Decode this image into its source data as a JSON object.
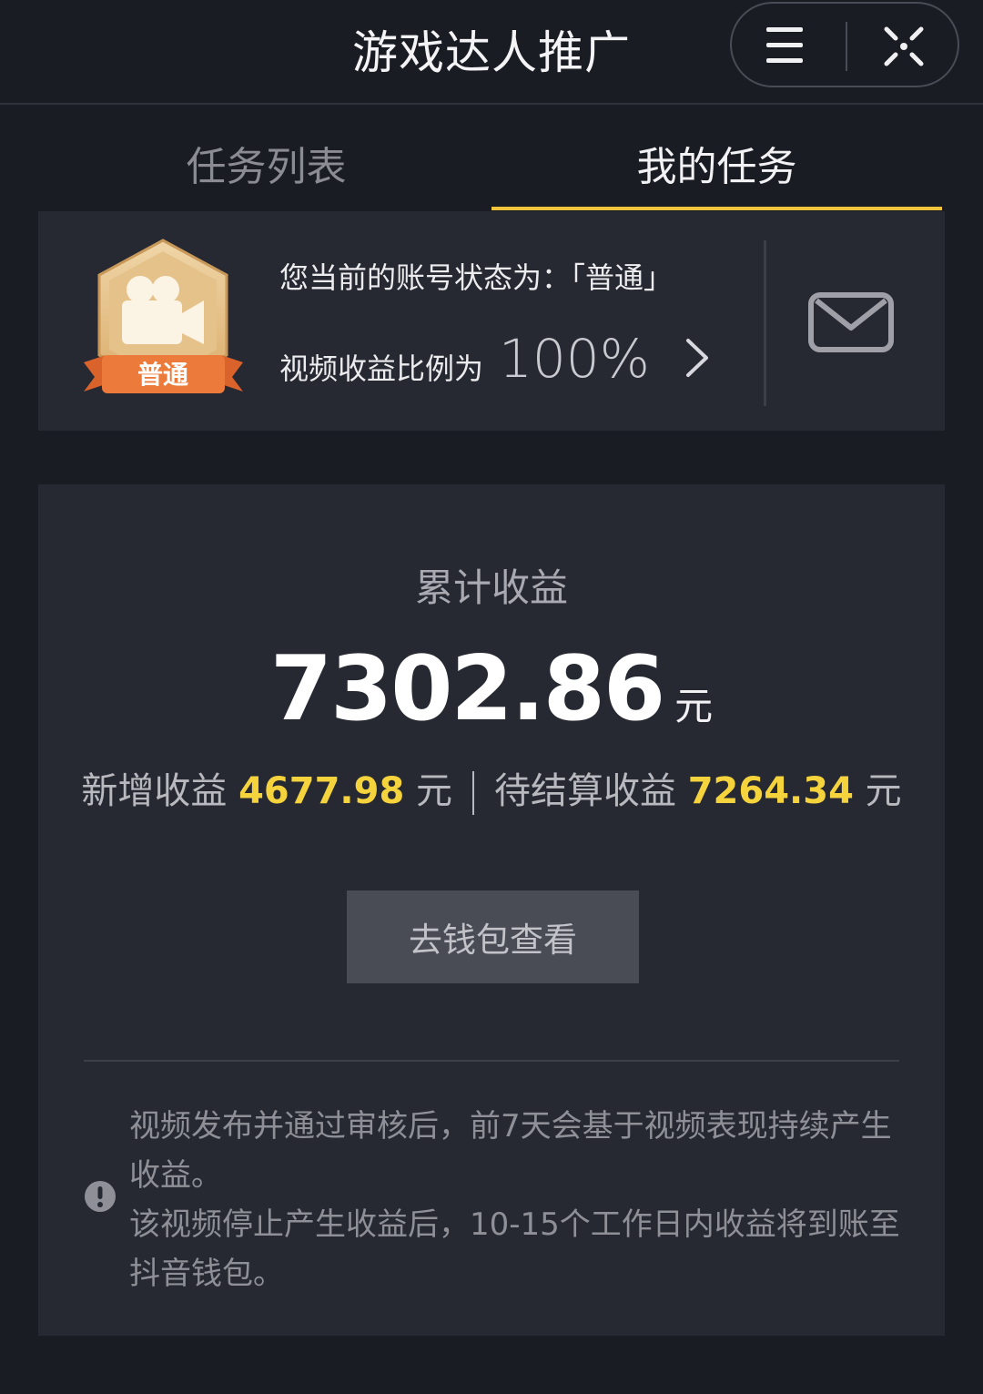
{
  "header": {
    "title": "游戏达人推广"
  },
  "tabs": [
    {
      "label": "任务列表",
      "active": false
    },
    {
      "label": "我的任务",
      "active": true
    }
  ],
  "status": {
    "badge_label": "普通",
    "account_status_line": "您当前的账号状态为：「普通」",
    "ratio_label": "视频收益比例为",
    "ratio_value": "100%"
  },
  "earnings": {
    "label": "累计收益",
    "total": "7302.86",
    "unit": "元",
    "new_label": "新增收益",
    "new_value": "4677.98",
    "pending_label": "待结算收益",
    "pending_value": "7264.34",
    "wallet_button": "去钱包查看"
  },
  "notice": {
    "line1": "视频发布并通过审核后，前7天会基于视频表现持续产生收益。",
    "line2": "该视频停止产生收益后，10-15个工作日内收益将到账至抖音钱包。"
  },
  "colors": {
    "background": "#1a1c24",
    "card": "#262832",
    "accent_yellow": "#f0c43a",
    "highlight_number": "#f5d33c",
    "badge_orange": "#ec7a3a",
    "badge_gold": "#e4c18e"
  },
  "icons": [
    "menu-icon",
    "close-icon",
    "camera-badge-icon",
    "chevron-right-icon",
    "mail-icon",
    "info-icon"
  ]
}
